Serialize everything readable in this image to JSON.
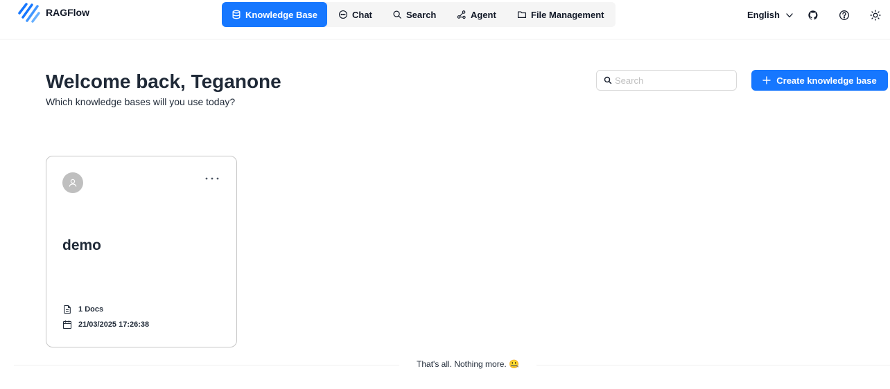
{
  "app": {
    "brand": "RAGFlow"
  },
  "nav": {
    "items": [
      {
        "label": "Knowledge Base",
        "icon": "database-icon",
        "active": true
      },
      {
        "label": "Chat",
        "icon": "chat-bubble-icon",
        "active": false
      },
      {
        "label": "Search",
        "icon": "search-icon",
        "active": false
      },
      {
        "label": "Agent",
        "icon": "agent-graph-icon",
        "active": false
      },
      {
        "label": "File Management",
        "icon": "folder-icon",
        "active": false
      }
    ]
  },
  "header_right": {
    "language": "English",
    "icons": [
      "github-icon",
      "help-icon",
      "theme-sun-icon"
    ]
  },
  "welcome": {
    "title": "Welcome back, Teganone",
    "subtitle": "Which knowledge bases will you use today?"
  },
  "search": {
    "placeholder": "Search",
    "value": ""
  },
  "create_button": {
    "label": "Create knowledge base",
    "icon": "plus-icon"
  },
  "knowledge_bases": [
    {
      "name": "demo",
      "doc_count": "1",
      "doc_unit": "Docs",
      "created": "21/03/2025 17:26:38"
    }
  ],
  "list_end": {
    "text": "That's all. Nothing more. 🤐"
  },
  "colors": {
    "primary": "#1677ff",
    "text": "#1f2937",
    "nav_bg": "#f5f5f5",
    "avatar_bg": "#bfbfbf",
    "card_border": "#c7c7c7"
  }
}
